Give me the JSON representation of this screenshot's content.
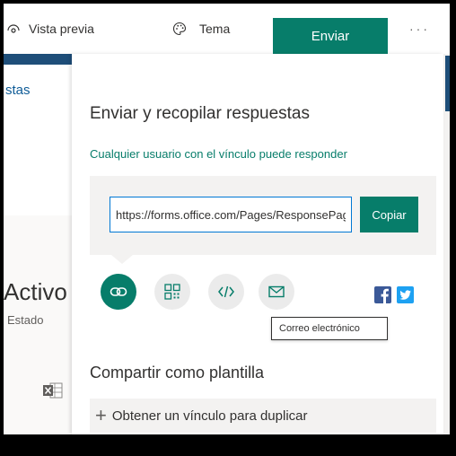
{
  "topbar": {
    "preview_label": "Vista previa",
    "theme_label": "Tema",
    "send_label": "Enviar",
    "more_label": "···"
  },
  "left": {
    "truncated_label": "stas",
    "activo_label": "Activo",
    "estado_label": "Estado"
  },
  "panel": {
    "title": "Enviar y recopilar respuestas",
    "access_link": "Cualquier usuario con el vínculo puede responder",
    "url_value": "https://forms.office.com/Pages/ResponsePage.aspx",
    "copy_label": "Copiar",
    "options": [
      {
        "name": "link-icon"
      },
      {
        "name": "qr-code-icon"
      },
      {
        "name": "embed-icon"
      },
      {
        "name": "email-icon"
      }
    ],
    "tooltip": "Correo electrónico",
    "share_title": "Compartir como plantilla",
    "duplicate_label": "Obtener un vínculo para duplicar",
    "colors": {
      "accent": "#077d6a",
      "facebook": "#3b5998",
      "twitter": "#1da1f2"
    }
  }
}
